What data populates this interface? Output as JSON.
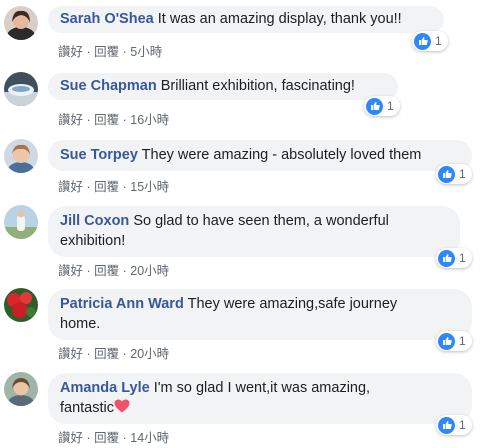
{
  "actions": {
    "like": "讚好",
    "reply": "回覆",
    "separator": " · "
  },
  "colors": {
    "author": "#385898",
    "bubble": "#f2f3f5",
    "like": "#2d88ff",
    "heart": "#f25268"
  },
  "comments": [
    {
      "author": "Sarah O'Shea",
      "text": "It was an amazing display, thank you!!",
      "time": "5小時",
      "likes": "1",
      "avatar_icon": "avatar-sarah"
    },
    {
      "author": "Sue Chapman",
      "text": "Brilliant exhibition, fascinating!",
      "time": "16小時",
      "likes": "1",
      "avatar_icon": "avatar-sue-chapman"
    },
    {
      "author": "Sue Torpey",
      "text": "They were amazing - absolutely loved them",
      "time": "15小時",
      "likes": "1",
      "avatar_icon": "avatar-sue-torpey"
    },
    {
      "author": "Jill Coxon",
      "text": "So glad to have seen them, a wonderful",
      "text2": "exhibition!",
      "time": "20小時",
      "likes": "1",
      "avatar_icon": "avatar-jill"
    },
    {
      "author": "Patricia Ann Ward",
      "text": "They were amazing,safe journey",
      "text2": "home.",
      "time": "20小時",
      "likes": "1",
      "avatar_icon": "avatar-patricia"
    },
    {
      "author": "Amanda Lyle",
      "text": "I'm so glad I went,it was amazing,",
      "text2": "fantastic",
      "emoji": "heart-emoji",
      "time": "14小時",
      "likes": "1",
      "avatar_icon": "avatar-amanda"
    }
  ]
}
